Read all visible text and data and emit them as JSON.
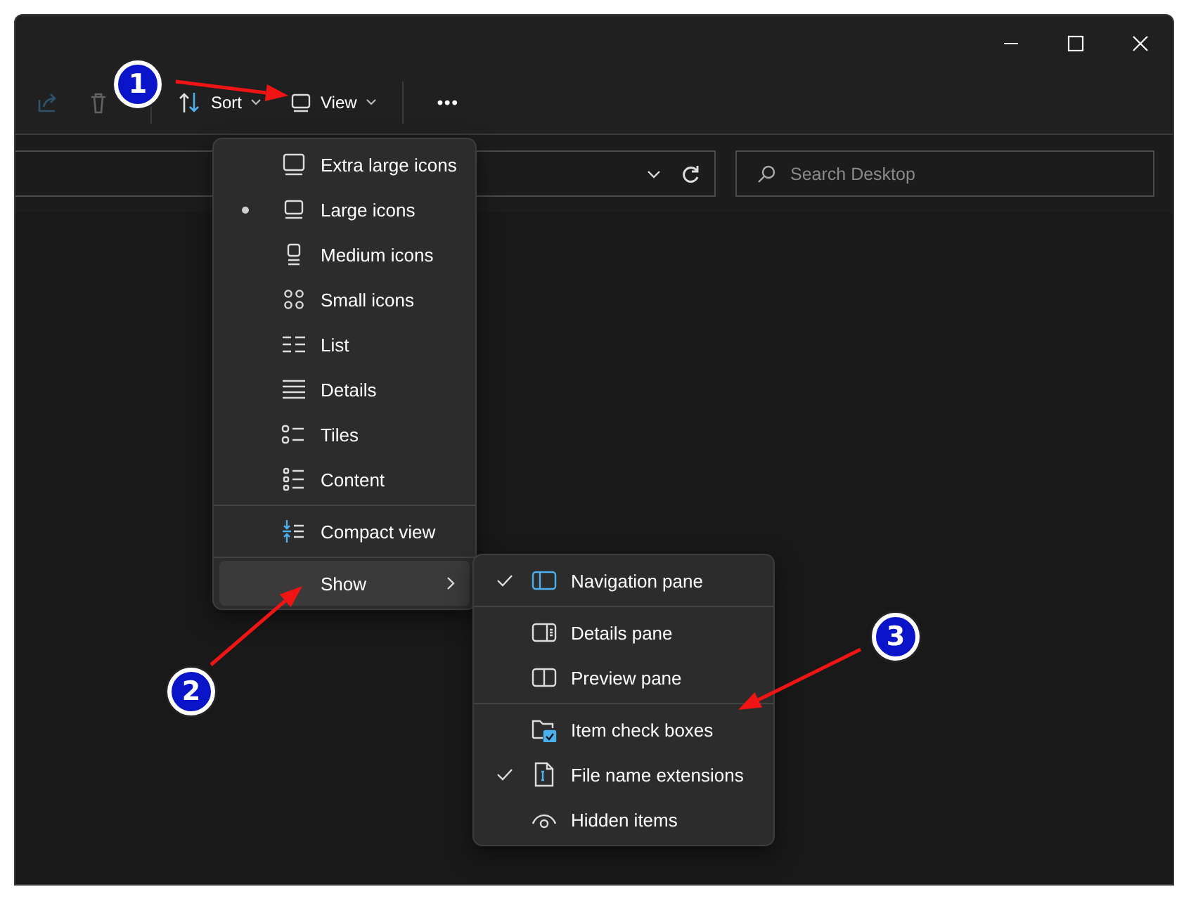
{
  "toolbar": {
    "buttons": [
      {
        "kind": "share",
        "disabled": true
      },
      {
        "kind": "delete",
        "disabled": true
      },
      {
        "kind": "sort",
        "label": "Sort"
      },
      {
        "kind": "view",
        "label": "View"
      },
      {
        "kind": "more",
        "label": "•••"
      }
    ]
  },
  "search": {
    "placeholder": "Search Desktop"
  },
  "view_menu": {
    "groups": [
      {
        "items": [
          {
            "kind": "option",
            "label": "Extra large icons",
            "selected": false
          },
          {
            "kind": "option",
            "label": "Large icons",
            "selected": true
          },
          {
            "kind": "option",
            "label": "Medium icons",
            "selected": false
          },
          {
            "kind": "option",
            "label": "Small icons",
            "selected": false
          },
          {
            "kind": "option",
            "label": "List",
            "selected": false
          },
          {
            "kind": "option",
            "label": "Details",
            "selected": false
          },
          {
            "kind": "option",
            "label": "Tiles",
            "selected": false
          },
          {
            "kind": "option",
            "label": "Content",
            "selected": false
          }
        ]
      },
      {
        "items": [
          {
            "kind": "toggle",
            "label": "Compact view",
            "checked": false
          }
        ]
      },
      {
        "items": [
          {
            "kind": "submenu",
            "label": "Show",
            "selected": true
          }
        ]
      }
    ]
  },
  "show_menu": {
    "groups": [
      {
        "items": [
          {
            "label": "Navigation pane",
            "checked": true
          }
        ]
      },
      {
        "items": [
          {
            "label": "Details pane",
            "checked": false
          },
          {
            "label": "Preview pane",
            "checked": false
          }
        ]
      },
      {
        "items": [
          {
            "label": "Item check boxes",
            "checked": false
          },
          {
            "label": "File name extensions",
            "checked": true
          },
          {
            "label": "Hidden items",
            "checked": false
          }
        ]
      }
    ]
  },
  "annotations": [
    {
      "label": "1"
    },
    {
      "label": "2"
    },
    {
      "label": "3"
    }
  ]
}
